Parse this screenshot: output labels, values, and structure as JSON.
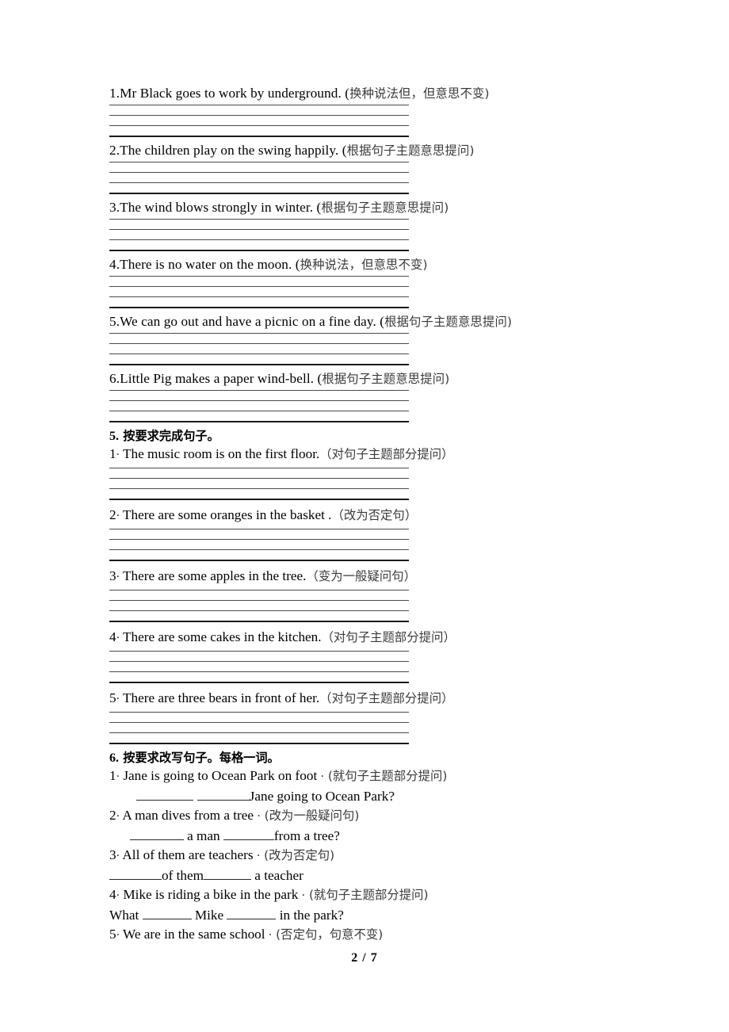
{
  "page": {
    "footer": "2 / 7"
  },
  "section4_items": [
    {
      "text": "1.Mr Black goes to work by underground. (",
      "cn": "换种说法但，但意思不变",
      "close": ")"
    },
    {
      "text": "2.The children play on the swing happily. (",
      "cn": "根据句子主题意思提问",
      "close": ")"
    },
    {
      "text": "3.The wind blows strongly in winter. (",
      "cn": "根据句子主题意思提问",
      "close": ")"
    },
    {
      "text": "4.There is no water on the moon. (",
      "cn": "换种说法，但意思不变",
      "close": ")"
    },
    {
      "text": "5.We can go out and have a picnic on a fine day. (",
      "cn": "根据句子主题意思提问",
      "close": ")"
    },
    {
      "text": "6.Little Pig makes a paper wind-bell. (",
      "cn": "根据句子主题意思提问",
      "close": ")"
    }
  ],
  "section5": {
    "heading_num": "5.",
    "heading_cn": " 按要求完成句子。",
    "items": [
      {
        "num": "1",
        "dot": "·",
        "text": " The music room is on the first floor.",
        "cn": "（对句子主题部分提问）"
      },
      {
        "num": "2",
        "dot": "·",
        "text": " There are some oranges in the basket .",
        "cn": "（改为否定句）"
      },
      {
        "num": "3",
        "dot": "·",
        "text": " There are some apples in the tree.",
        "cn": "（变为一般疑问句）"
      },
      {
        "num": "4",
        "dot": "·",
        "text": " There are some cakes in the kitchen.",
        "cn": "（对句子主题部分提问）"
      },
      {
        "num": "5",
        "dot": "·",
        "text": " There are three bears in front of her.",
        "cn": "（对句子主题部分提问）"
      }
    ]
  },
  "section6": {
    "heading_num": "6.",
    "heading_cn": " 按要求改写句子。每格一词。",
    "items": [
      {
        "prompt_num": "1",
        "prompt_dot": "·",
        "prompt_text": " Jane is going to Ocean Park on foot ",
        "prompt_dot2": "·",
        "prompt_cn": " (就句子主题部分提问)",
        "answer_pre": "        ",
        "answer_mid": " ",
        "answer_post": "Jane going to Ocean Park?"
      },
      {
        "prompt_num": "2",
        "prompt_dot": "·",
        "prompt_text": " A man dives from a tree ",
        "prompt_dot2": "·",
        "prompt_cn": " (改为一般疑问句)",
        "answer_pre": "      ",
        "answer_mid": " a man ",
        "answer_post": "from a tree?"
      },
      {
        "prompt_num": "3",
        "prompt_dot": "·",
        "prompt_text": " All of them are teachers ",
        "prompt_dot2": "·",
        "prompt_cn": " (改为否定句)",
        "answer_pre": "",
        "answer_mid": "of them",
        "answer_post": " a teacher"
      },
      {
        "prompt_num": "4",
        "prompt_dot": "·",
        "prompt_text": " Mike is riding a bike in the park ",
        "prompt_dot2": "·",
        "prompt_cn": " (就句子主题部分提问)",
        "answer_pre": "What ",
        "answer_mid": " Mike ",
        "answer_post": " in the park?"
      },
      {
        "prompt_num": "5",
        "prompt_dot": "·",
        "prompt_text": " We are in the same school ",
        "prompt_dot2": "·",
        "prompt_cn": " (否定句，句意不变)",
        "answer_pre": "",
        "answer_mid": "",
        "answer_post": ""
      }
    ]
  }
}
